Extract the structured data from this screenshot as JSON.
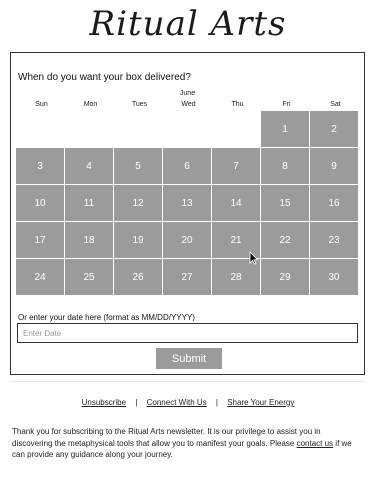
{
  "brand": {
    "title": "Ritual Arts"
  },
  "delivery": {
    "question": "When do you want your box delivered?",
    "month": "June",
    "weekdays": [
      "Sun",
      "Mon",
      "Tues",
      "Wed",
      "Thu",
      "Fri",
      "Sat"
    ],
    "leading_empty_cells": 5,
    "days": [
      "1",
      "2",
      "3",
      "4",
      "5",
      "6",
      "7",
      "8",
      "9",
      "10",
      "11",
      "12",
      "13",
      "14",
      "15",
      "16",
      "17",
      "18",
      "19",
      "20",
      "21",
      "22",
      "23",
      "24",
      "25",
      "26",
      "27",
      "28",
      "29",
      "30"
    ],
    "manual_label": "Or enter your date here (format as MM/DD/YYYY)",
    "input_placeholder": "Enter Date",
    "input_value": "",
    "submit_label": "Submit"
  },
  "footer": {
    "links": [
      "Unsubscribe",
      "Connect With Us",
      "Share Your Energy"
    ],
    "separator": "|",
    "message_before_link": "Thank you for subscribing to the Ritual Arts newsletter. It is our privilege to assist you in discovering the metaphysical tools that allow you to manifest your goals. Please ",
    "contact_link": "contact us",
    "message_after_link": " if we can provide any guidance along your journey."
  },
  "colors": {
    "calendar_cell": "#9b9b9b",
    "submit_button": "#9b9b9b",
    "text": "#222222"
  }
}
